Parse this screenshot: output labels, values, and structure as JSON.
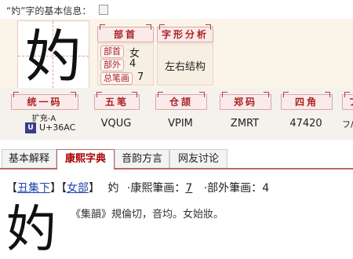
{
  "title": {
    "text": "“妁”字的基本信息：",
    "icon": "document-icon"
  },
  "character": "妁",
  "headers": {
    "radical": "部首",
    "structure": "字形分析",
    "unicode": "统一码",
    "wubi": "五笔",
    "cangjie": "仓颉",
    "zhengma": "郑码",
    "sijiao": "四角",
    "extra": "フ"
  },
  "radical_info": {
    "radical_label": "部首",
    "radical_value": "女",
    "outside_label": "部外",
    "outside_value": "4",
    "total_label": "总笔画",
    "total_value": "7"
  },
  "structure_value": "左右结构",
  "codes": {
    "unicode_block": "扩充-A",
    "unicode_logo": "U",
    "unicode_value": "U+36AC",
    "wubi": "VQUG",
    "cangjie": "VPIM",
    "zhengma": "ZMRT",
    "sijiao": "47420",
    "extra": "フ/"
  },
  "tabs": [
    {
      "label": "基本解释"
    },
    {
      "label": "康熙字典"
    },
    {
      "label": "音韵方言"
    },
    {
      "label": "网友讨论"
    }
  ],
  "kangxi": {
    "open1": "【",
    "ji": "丑集下",
    "close1": "】",
    "open2": "【",
    "bu": "女部",
    "close2": "】",
    "char": "妁",
    "stroke_label": "·康熙筆画：",
    "stroke_value": "7",
    "outside_label": "·部外筆画：",
    "outside_value": "4",
    "quote": "《集韻》規倫切，音均。女始妝。"
  }
}
